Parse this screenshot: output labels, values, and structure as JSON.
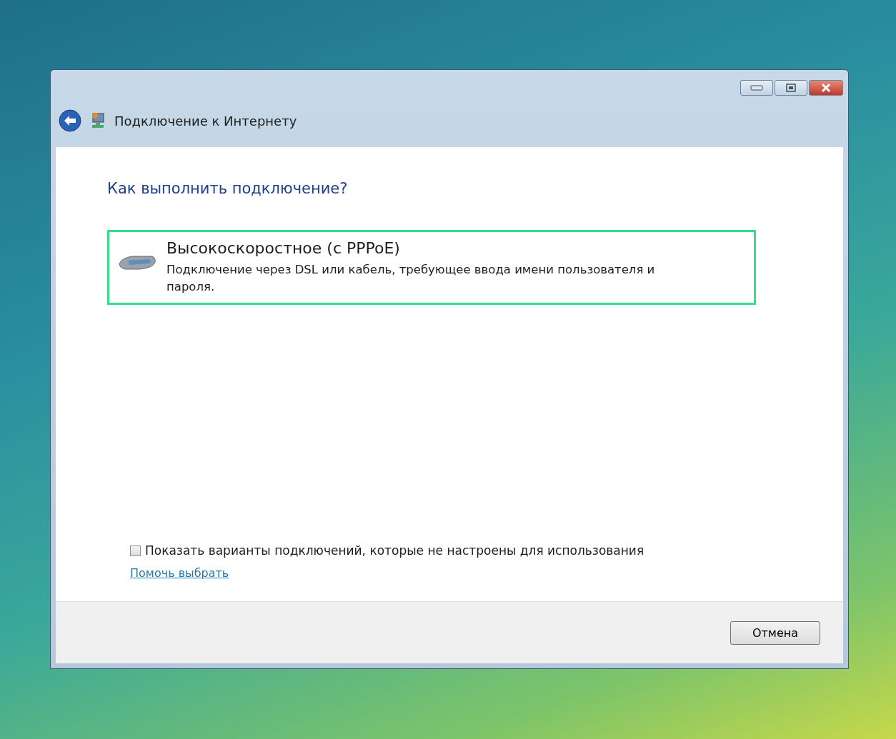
{
  "window": {
    "title": "Подключение к Интернету"
  },
  "heading": "Как выполнить подключение?",
  "options": [
    {
      "title": "Высокоскоростное (с PPPoE)",
      "description": "Подключение через DSL или кабель, требующее ввода имени пользователя и пароля.",
      "selected": true
    }
  ],
  "show_all": {
    "label": "Показать варианты подключений, которые не настроены для использования",
    "checked": false
  },
  "help_link": "Помочь выбрать",
  "buttons": [
    "Отмена"
  ]
}
